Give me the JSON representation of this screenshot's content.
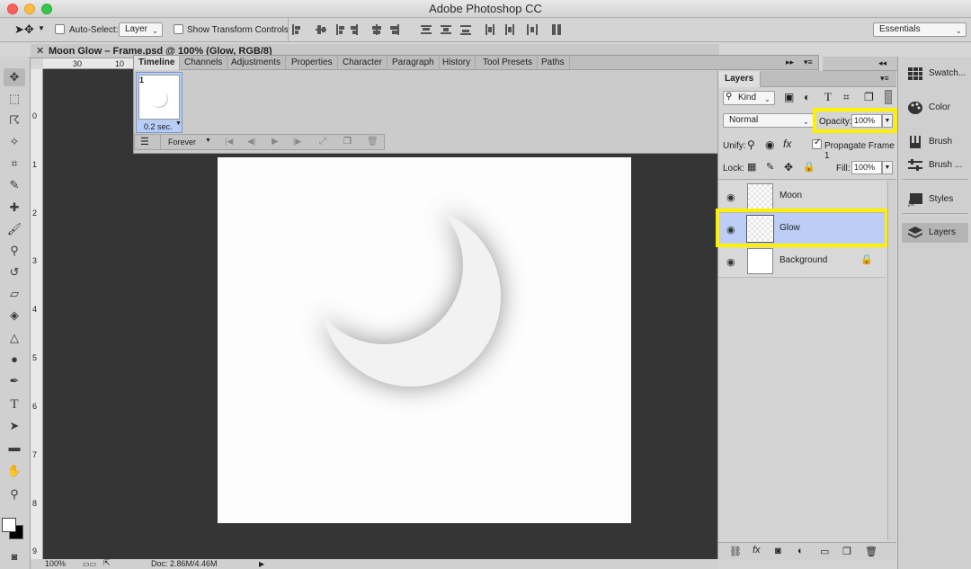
{
  "app": {
    "title": "Adobe Photoshop CC"
  },
  "options": {
    "auto_select_label": "Auto-Select:",
    "auto_select_value": "Layer",
    "transform_label": "Show Transform Controls",
    "workspace": "Essentials"
  },
  "document": {
    "tab_title": "Moon Glow – Frame.psd @ 100% (Glow, RGB/8)",
    "ruler_top": [
      "30",
      "10"
    ],
    "ruler_left": [
      "0",
      "1",
      "2",
      "3",
      "4",
      "5",
      "6",
      "7",
      "8",
      "9"
    ],
    "zoom": "100%",
    "doc_size": "Doc: 2.86M/4.46M"
  },
  "timeline": {
    "tabs": [
      "Timeline",
      "Channels",
      "Adjustments",
      "Properties",
      "Character",
      "Paragraph",
      "History",
      "Tool Presets",
      "Paths"
    ],
    "frame_number": "1",
    "frame_delay": "0.2 sec.",
    "loop": "Forever"
  },
  "layers_panel": {
    "title": "Layers",
    "filter_kind": "Kind",
    "blend_mode": "Normal",
    "opacity_label": "Opacity:",
    "opacity_value": "100%",
    "unify_label": "Unify:",
    "propagate_label": "Propagate Frame 1",
    "lock_label": "Lock:",
    "fill_label": "Fill:",
    "fill_value": "100%",
    "layers": [
      {
        "name": "Moon",
        "selected": false
      },
      {
        "name": "Glow",
        "selected": true
      },
      {
        "name": "Background",
        "selected": false,
        "locked": true
      }
    ]
  },
  "dock": {
    "items": [
      "Swatch...",
      "Color",
      "Brush",
      "Brush ...",
      "Styles",
      "Layers"
    ]
  },
  "colors": {
    "highlight": "#fff000",
    "selected_row": "#bccdf6",
    "canvas": "#353535"
  }
}
